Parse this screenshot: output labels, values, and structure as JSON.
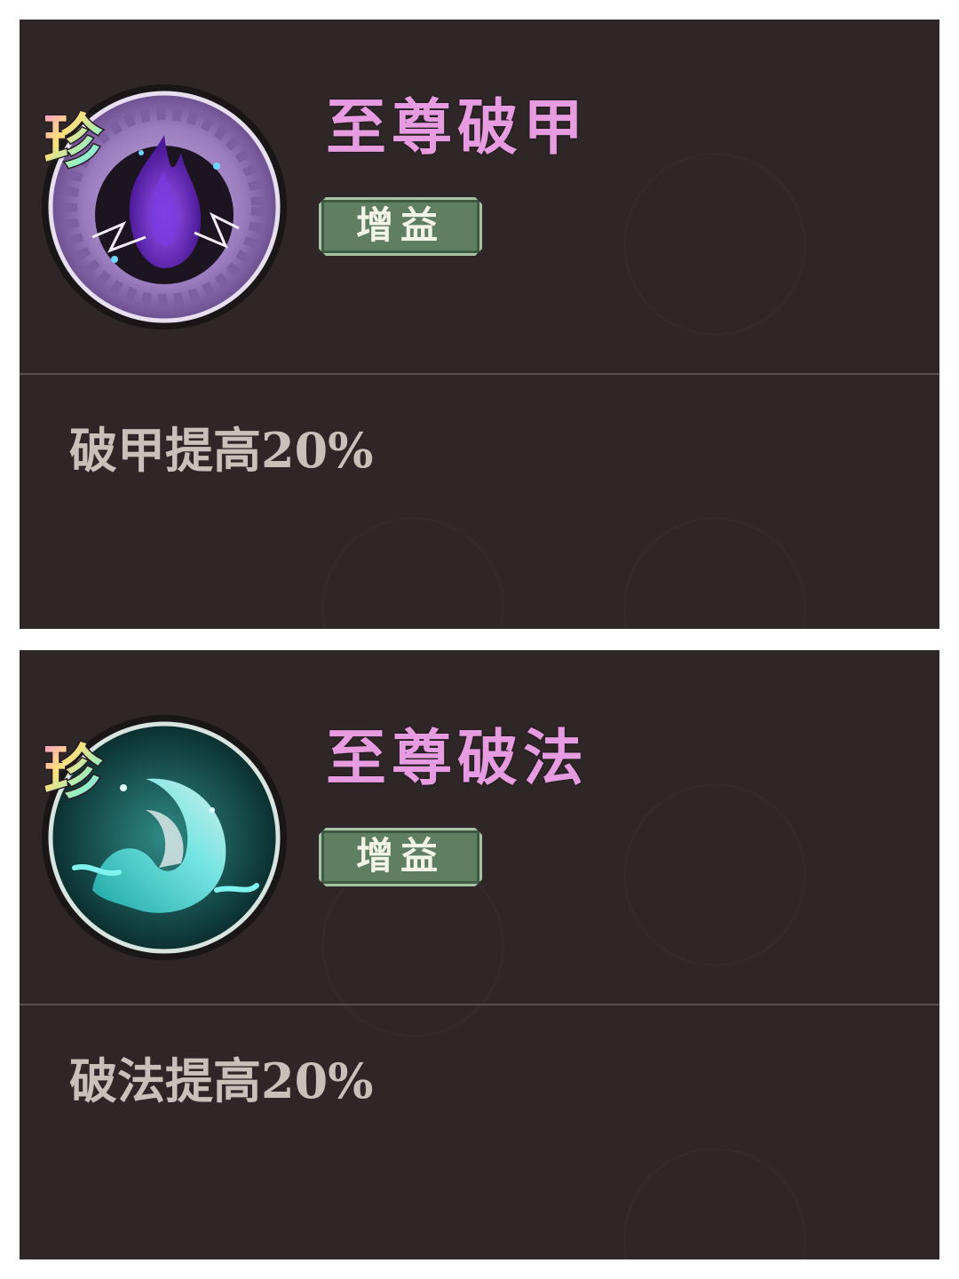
{
  "buffs": [
    {
      "title": "至尊破甲",
      "tag": "增益",
      "description": "破甲提高20%",
      "rarity_badge": "珍",
      "icon": "purple-flame-icon",
      "title_color": "#e79be0"
    },
    {
      "title": "至尊破法",
      "tag": "增益",
      "description": "破法提高20%",
      "rarity_badge": "珍",
      "icon": "teal-wave-icon",
      "title_color": "#e79be0"
    }
  ]
}
